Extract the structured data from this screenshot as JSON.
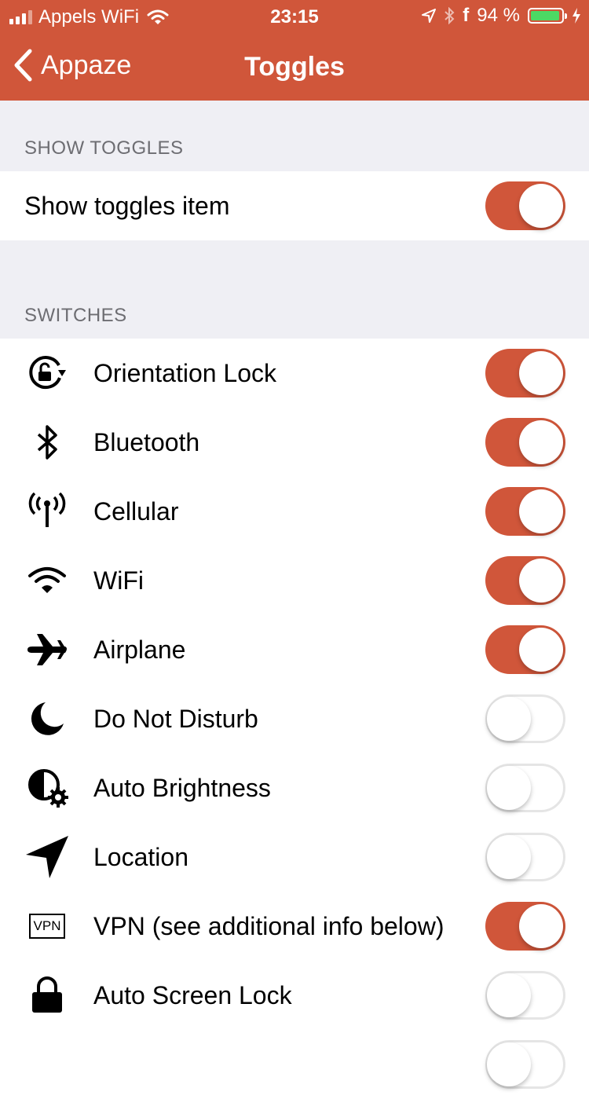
{
  "status_bar": {
    "carrier": "Appels WiFi",
    "time": "23:15",
    "battery": "94 %",
    "battery_level": 0.94,
    "icons": [
      "signal-icon",
      "wifi-icon",
      "location-arrow-icon",
      "bluetooth-icon",
      "facebook-icon",
      "battery-icon",
      "charging-bolt-icon"
    ]
  },
  "nav": {
    "back_label": "Appaze",
    "title": "Toggles"
  },
  "colors": {
    "accent": "#d0563a",
    "background": "#efeff4",
    "header_text": "#6d6d72",
    "battery_fill": "#4cd964"
  },
  "show_section": {
    "header": "SHOW TOGGLES",
    "item": {
      "label": "Show toggles item",
      "on": true
    }
  },
  "switches_section": {
    "header": "SWITCHES",
    "items": [
      {
        "icon": "orientation-lock-icon",
        "label": "Orientation Lock",
        "on": true
      },
      {
        "icon": "bluetooth-icon",
        "label": "Bluetooth",
        "on": true
      },
      {
        "icon": "cellular-antenna-icon",
        "label": "Cellular",
        "on": true
      },
      {
        "icon": "wifi-icon",
        "label": "WiFi",
        "on": true
      },
      {
        "icon": "airplane-icon",
        "label": "Airplane",
        "on": true
      },
      {
        "icon": "moon-icon",
        "label": "Do Not Disturb",
        "on": false
      },
      {
        "icon": "auto-brightness-icon",
        "label": "Auto Brightness",
        "on": false
      },
      {
        "icon": "location-icon",
        "label": "Location",
        "on": false
      },
      {
        "icon": "vpn-icon",
        "icon_text": "VPN",
        "label": "VPN (see additional info below)",
        "on": true
      },
      {
        "icon": "lock-icon",
        "label": "Auto Screen Lock",
        "on": false
      }
    ]
  }
}
